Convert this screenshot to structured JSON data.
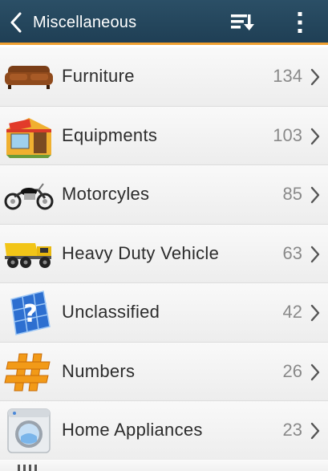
{
  "header": {
    "title": "Miscellaneous",
    "back_icon": "chevron-left-icon",
    "sort_icon": "sort-list-icon",
    "menu_icon": "more-vertical-icon",
    "accent": "#f0a030",
    "bar_color": "#24475d"
  },
  "categories": [
    {
      "label": "Furniture",
      "count": "134",
      "icon": "sofa-icon"
    },
    {
      "label": "Equipments",
      "count": "103",
      "icon": "shop-icon"
    },
    {
      "label": "Motorcyles",
      "count": "85",
      "icon": "motorcycle-icon"
    },
    {
      "label": "Heavy Duty Vehicle",
      "count": "63",
      "icon": "dump-truck-icon"
    },
    {
      "label": "Unclassified",
      "count": "42",
      "icon": "question-map-icon"
    },
    {
      "label": "Numbers",
      "count": "26",
      "icon": "hash-icon"
    },
    {
      "label": "Home Appliances",
      "count": "23",
      "icon": "washing-machine-icon"
    }
  ]
}
